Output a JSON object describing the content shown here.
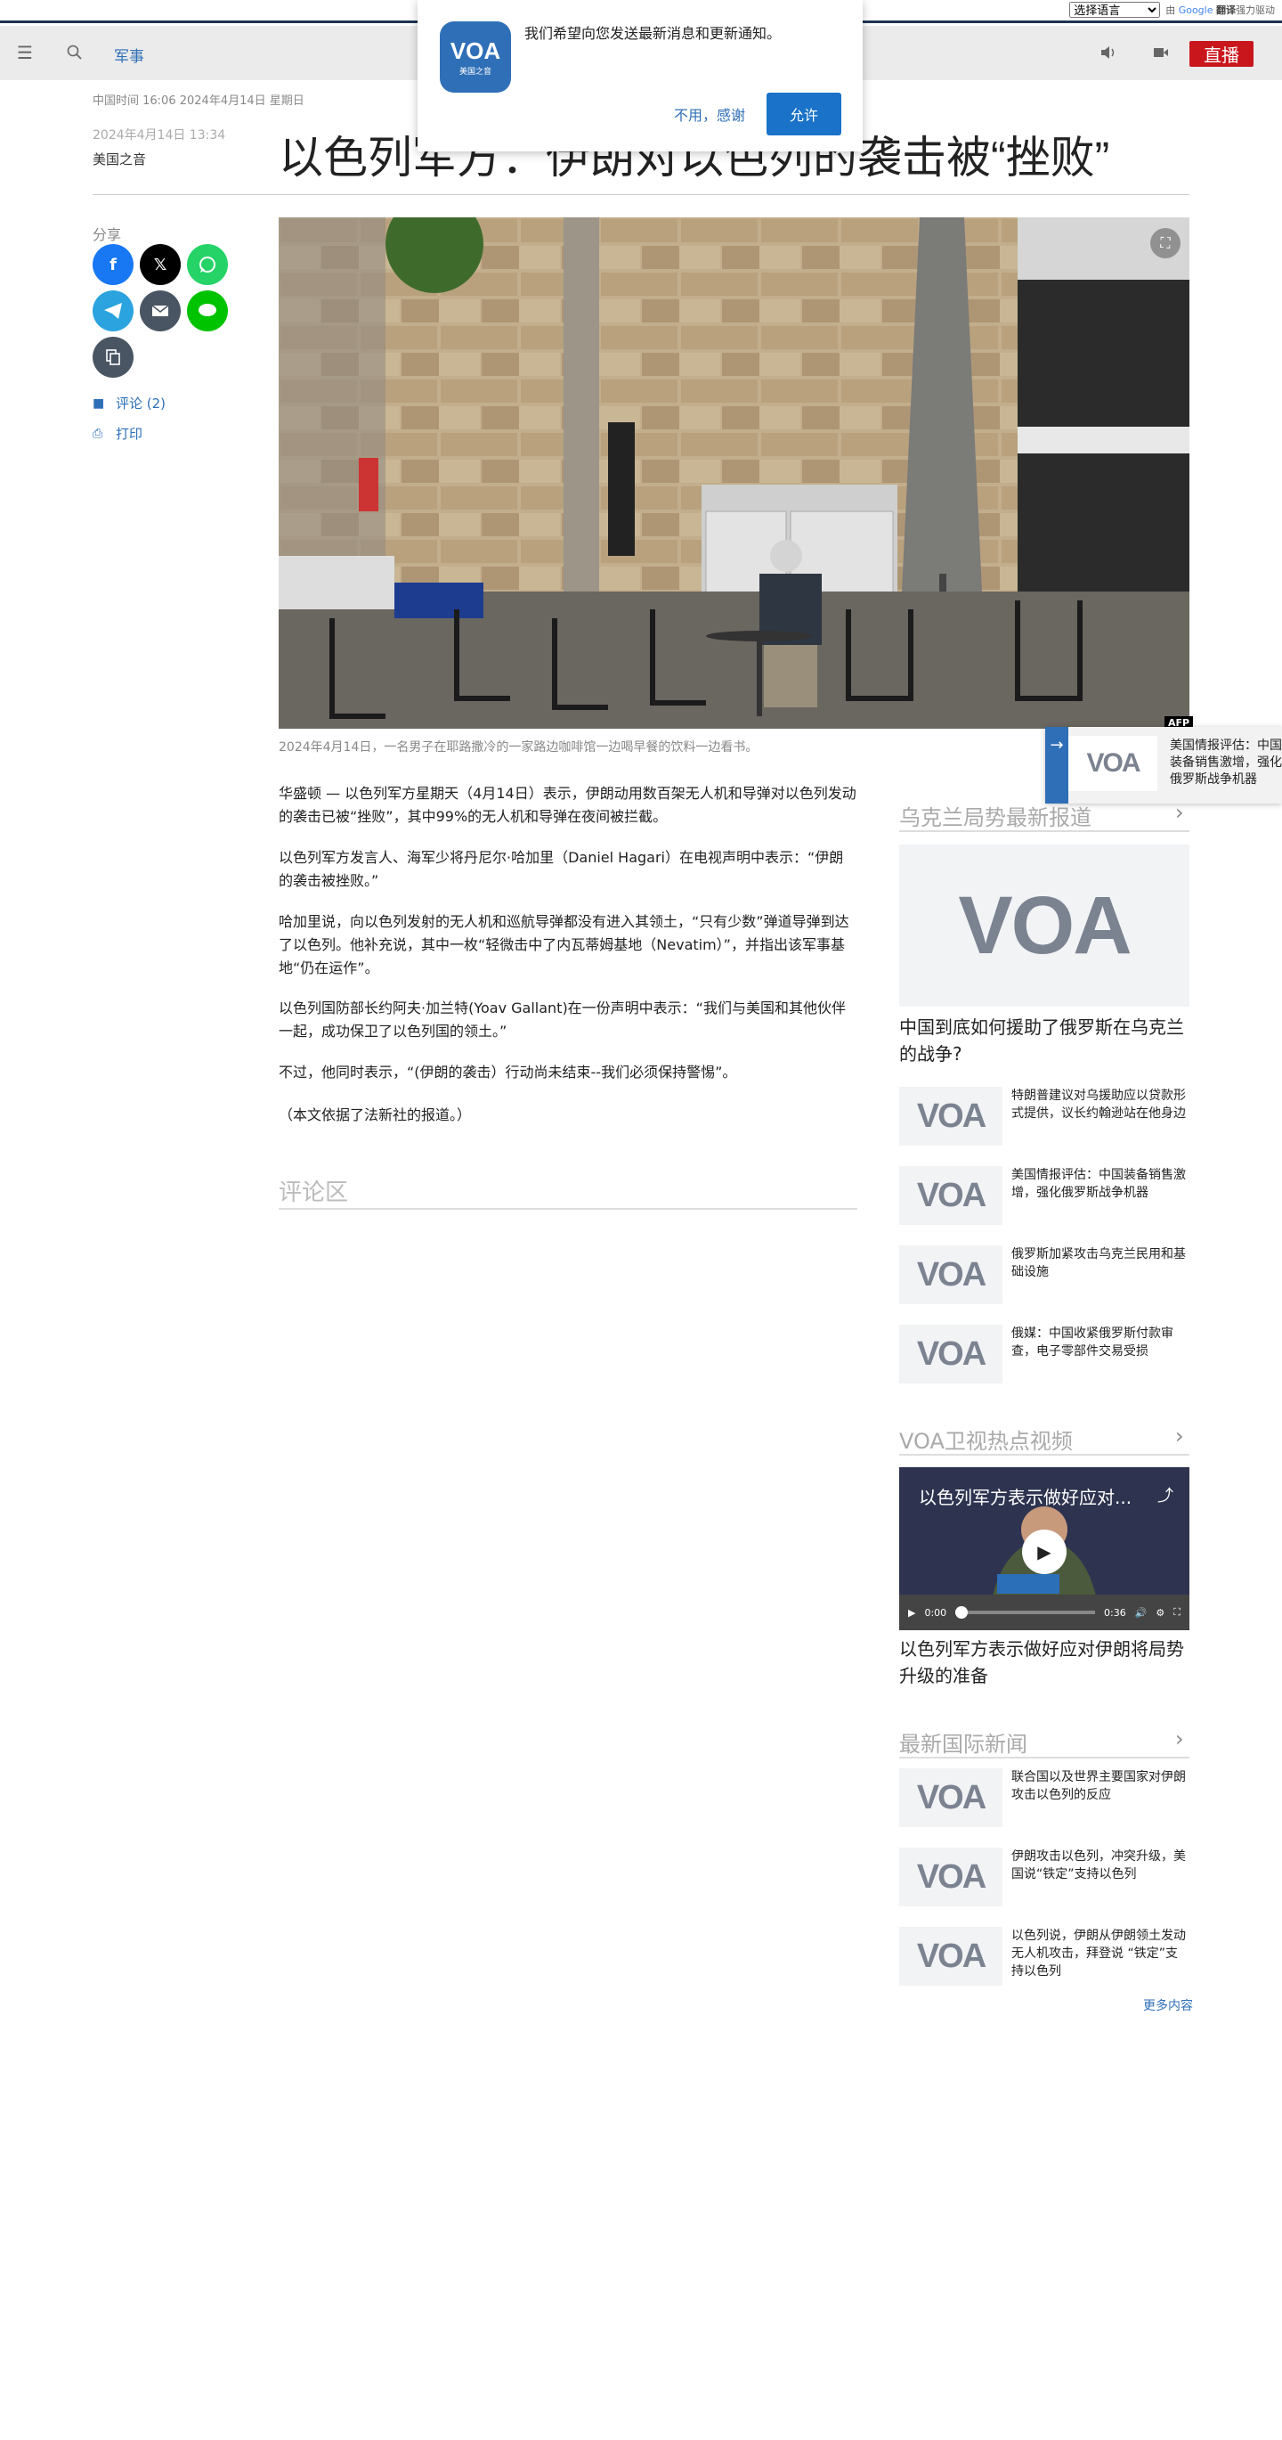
{
  "translate": {
    "select_label": "选择语言",
    "powered_prefix": "由",
    "google": "Google",
    "powered_suffix": "翻译",
    "powered_tail": "强力驱动"
  },
  "nav": {
    "section": "军事",
    "live": "直播"
  },
  "article": {
    "dateline": "中国时间 16:06 2024年4月14日 星期日",
    "pubdate": "2024年4月14日 13:34",
    "author": "美国之音",
    "headline": "以色列军方：伊朗对以色列的袭击被“挫败”",
    "photo_caption": "2024年4月14日，一名男子在耶路撒冷的一家路边咖啡馆一边喝早餐的饮料一边看书。",
    "photo_credit": "AFP",
    "paragraphs": [
      "华盛顿 — 以色列军方星期天（4月14日）表示，伊朗动用数百架无人机和导弹对以色列发动的袭击已被“挫败”，其中99%的无人机和导弹在夜间被拦截。",
      "以色列军方发言人、海军少将丹尼尔·哈加里（Daniel Hagari）在电视声明中表示：“伊朗的袭击被挫败。”",
      "哈加里说，向以色列发射的无人机和巡航导弹都没有进入其领土，“只有少数”弹道导弹到达了以色列。他补充说，其中一枚“轻微击中了内瓦蒂姆基地（Nevatim）”，并指出该军事基地“仍在运作”。",
      "以色列国防部长约阿夫·加兰特(Yoav Gallant)在一份声明中表示：“我们与美国和其他伙伴一起，成功保卫了以色列国的领土。”",
      "不过，他同时表示，“(伊朗的袭击）行动尚未结束--我们必须保持警惕”。",
      "（本文依据了法新社的报道。）"
    ],
    "comments_heading": "评论区"
  },
  "share": {
    "label": "分享",
    "comments_link": "评论 (2)",
    "print_link": "打印"
  },
  "sidebar": {
    "ukraine": {
      "heading": "乌克兰局势最新报道",
      "featured_title": "中国到底如何援助了俄罗斯在乌克兰的战争?",
      "items": [
        "特朗普建议对乌援助应以贷款形式提供，议长约翰逊站在他身边",
        "美国情报评估：中国装备销售激增，强化俄罗斯战争机器",
        "俄罗斯加紧攻击乌克兰民用和基础设施",
        "俄媒：中国收紧俄罗斯付款审查，电子零部件交易受损"
      ]
    },
    "videos": {
      "heading": "VOA卫视热点视频",
      "video_overlay_title": "以色列军方表示做好应对...",
      "current_time": "0:00",
      "duration": "0:36",
      "progress": 0,
      "video_title": "以色列军方表示做好应对伊朗将局势升级的准备"
    },
    "intl": {
      "heading": "最新国际新闻",
      "items": [
        "联合国以及世界主要国家对伊朗攻击以色列的反应",
        "伊朗攻击以色列，冲突升级，美国说“铁定”支持以色列",
        "以色列说，伊朗从伊朗领土发动无人机攻击，拜登说 “铁定”支持以色列"
      ],
      "more": "更多内容"
    }
  },
  "popup": {
    "app_name": "VOA",
    "app_sub": "美国之音",
    "message": "我们希望向您发送最新消息和更新通知。",
    "deny": "不用，感谢",
    "allow": "允许"
  },
  "toast": {
    "text": "美国情报评估：中国装备销售激增，强化俄罗斯战争机器"
  },
  "logo_text": "VOA",
  "colors": {
    "accent": "#2f6fb7",
    "live": "#c9161c",
    "allow": "#1a73c8",
    "facebook": "#1877f2",
    "x": "#000000",
    "whatsapp": "#25d366",
    "telegram": "#2aa3df",
    "email": "#4a5563",
    "line": "#00c300"
  },
  "icons": {
    "menu": "menu-icon",
    "search": "search-icon",
    "audio": "speaker-icon",
    "video": "video-camera-icon",
    "expand": "expand-icon",
    "comment": "comment-icon",
    "print": "printer-icon",
    "copy": "copy-icon"
  }
}
